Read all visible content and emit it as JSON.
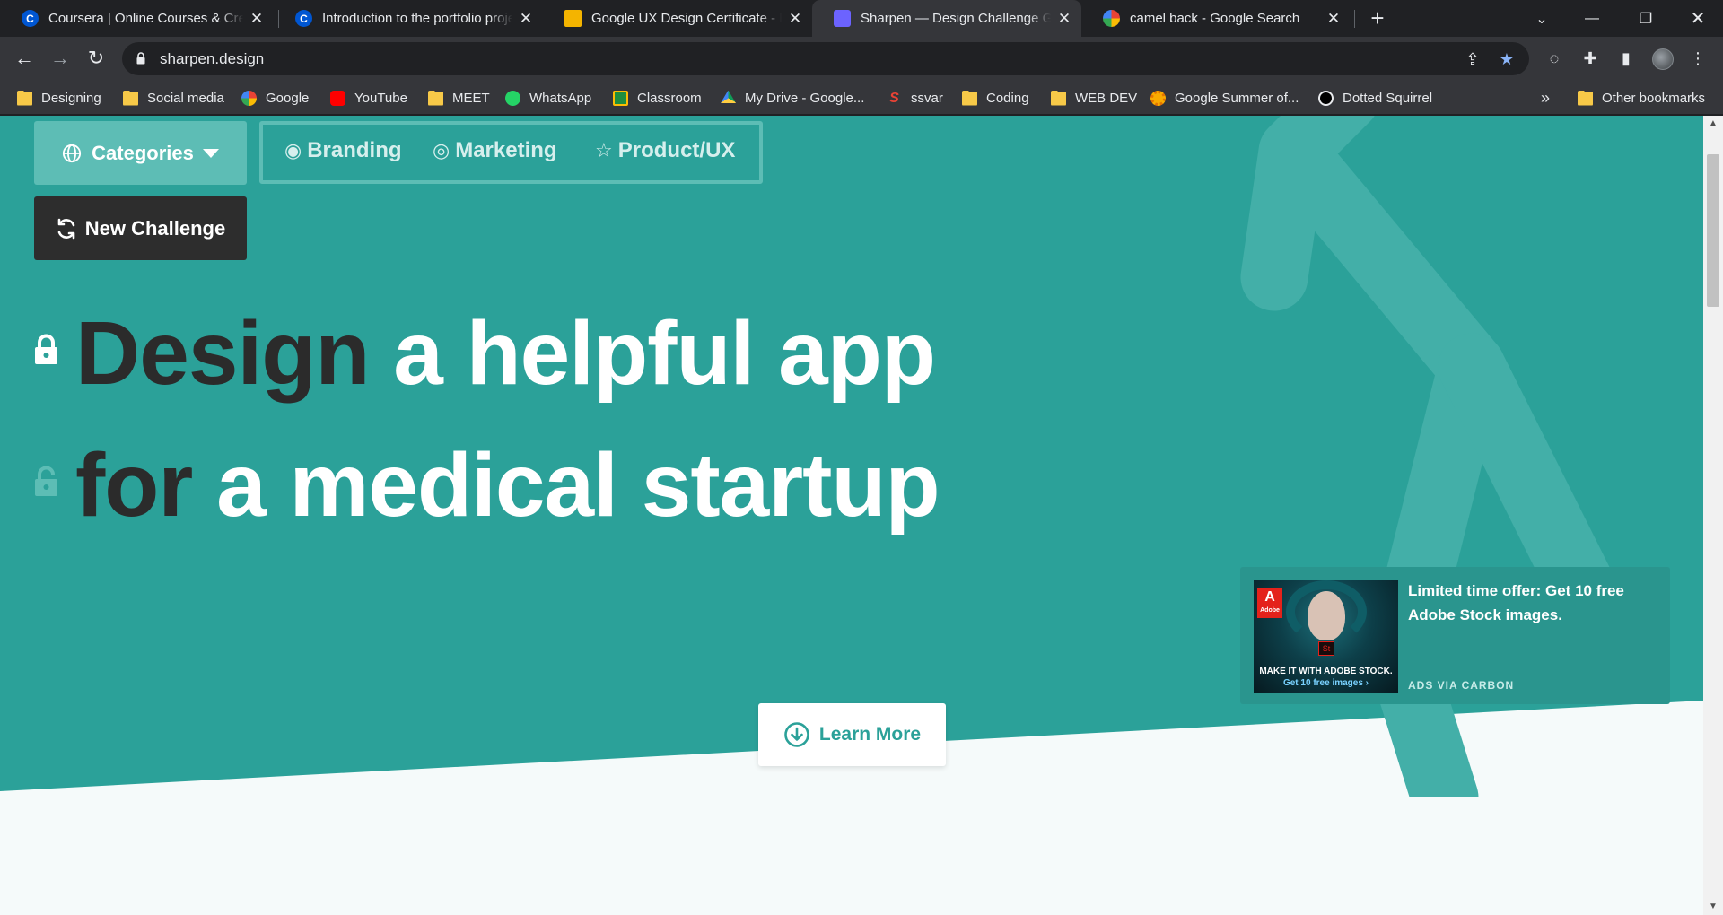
{
  "browser": {
    "tabs": [
      {
        "title": "Coursera | Online Courses & Credentials From Top Educators",
        "icon": "coursera-icon",
        "active": false
      },
      {
        "title": "Introduction to the portfolio project",
        "icon": "coursera-icon",
        "active": false
      },
      {
        "title": "Google UX Design Certificate - Portfolio",
        "icon": "google-slides-icon",
        "active": false
      },
      {
        "title": "Sharpen — Design Challenge Generator",
        "icon": "sharpen-icon",
        "active": true
      },
      {
        "title": "camel back - Google Search",
        "icon": "google-icon",
        "active": false
      }
    ],
    "url": "sharpen.design",
    "bookmarks": [
      {
        "label": "Designing",
        "icon": "folder-icon"
      },
      {
        "label": "Social media",
        "icon": "folder-icon"
      },
      {
        "label": "Google",
        "icon": "google-icon"
      },
      {
        "label": "YouTube",
        "icon": "youtube-icon"
      },
      {
        "label": "MEET",
        "icon": "folder-icon"
      },
      {
        "label": "WhatsApp",
        "icon": "whatsapp-icon"
      },
      {
        "label": "Classroom",
        "icon": "classroom-icon"
      },
      {
        "label": "My Drive - Google...",
        "icon": "google-drive-icon"
      },
      {
        "label": "ssvar",
        "icon": "ssvar-icon"
      },
      {
        "label": "Coding",
        "icon": "folder-icon"
      },
      {
        "label": "WEB DEV",
        "icon": "folder-icon"
      },
      {
        "label": "Google Summer of...",
        "icon": "gsoc-icon"
      },
      {
        "label": "Dotted Squirrel",
        "icon": "dotted-squirrel-icon"
      }
    ],
    "bookmarks_overflow": "»",
    "other_bookmarks": "Other bookmarks"
  },
  "page": {
    "categories_label": "Categories",
    "filters": [
      {
        "label": "Branding",
        "icon": "eye-icon"
      },
      {
        "label": "Marketing",
        "icon": "target-icon"
      },
      {
        "label": "Product/UX",
        "icon": "star-icon"
      }
    ],
    "new_challenge_label": "New Challenge",
    "headline": {
      "line1": {
        "verb": "Design",
        "object": "a helpful app"
      },
      "line2": {
        "prep": "for",
        "target": "a medical startup"
      }
    },
    "ad": {
      "logo_text": "A",
      "logo_sub": "Adobe",
      "product_badge": "St",
      "image_tagline": "MAKE IT WITH ADOBE STOCK.",
      "image_cta": "Get 10 free images ›",
      "text": "Limited time offer: Get 10 free Adobe Stock images.",
      "via": "ADS VIA CARBON"
    },
    "learn_more_label": "Learn More"
  },
  "colors": {
    "hero_teal": "#2ba199",
    "hero_light_teal": "#5dbdb5",
    "dark_button": "#2d2d2d",
    "page_background": "#f5fafa"
  }
}
